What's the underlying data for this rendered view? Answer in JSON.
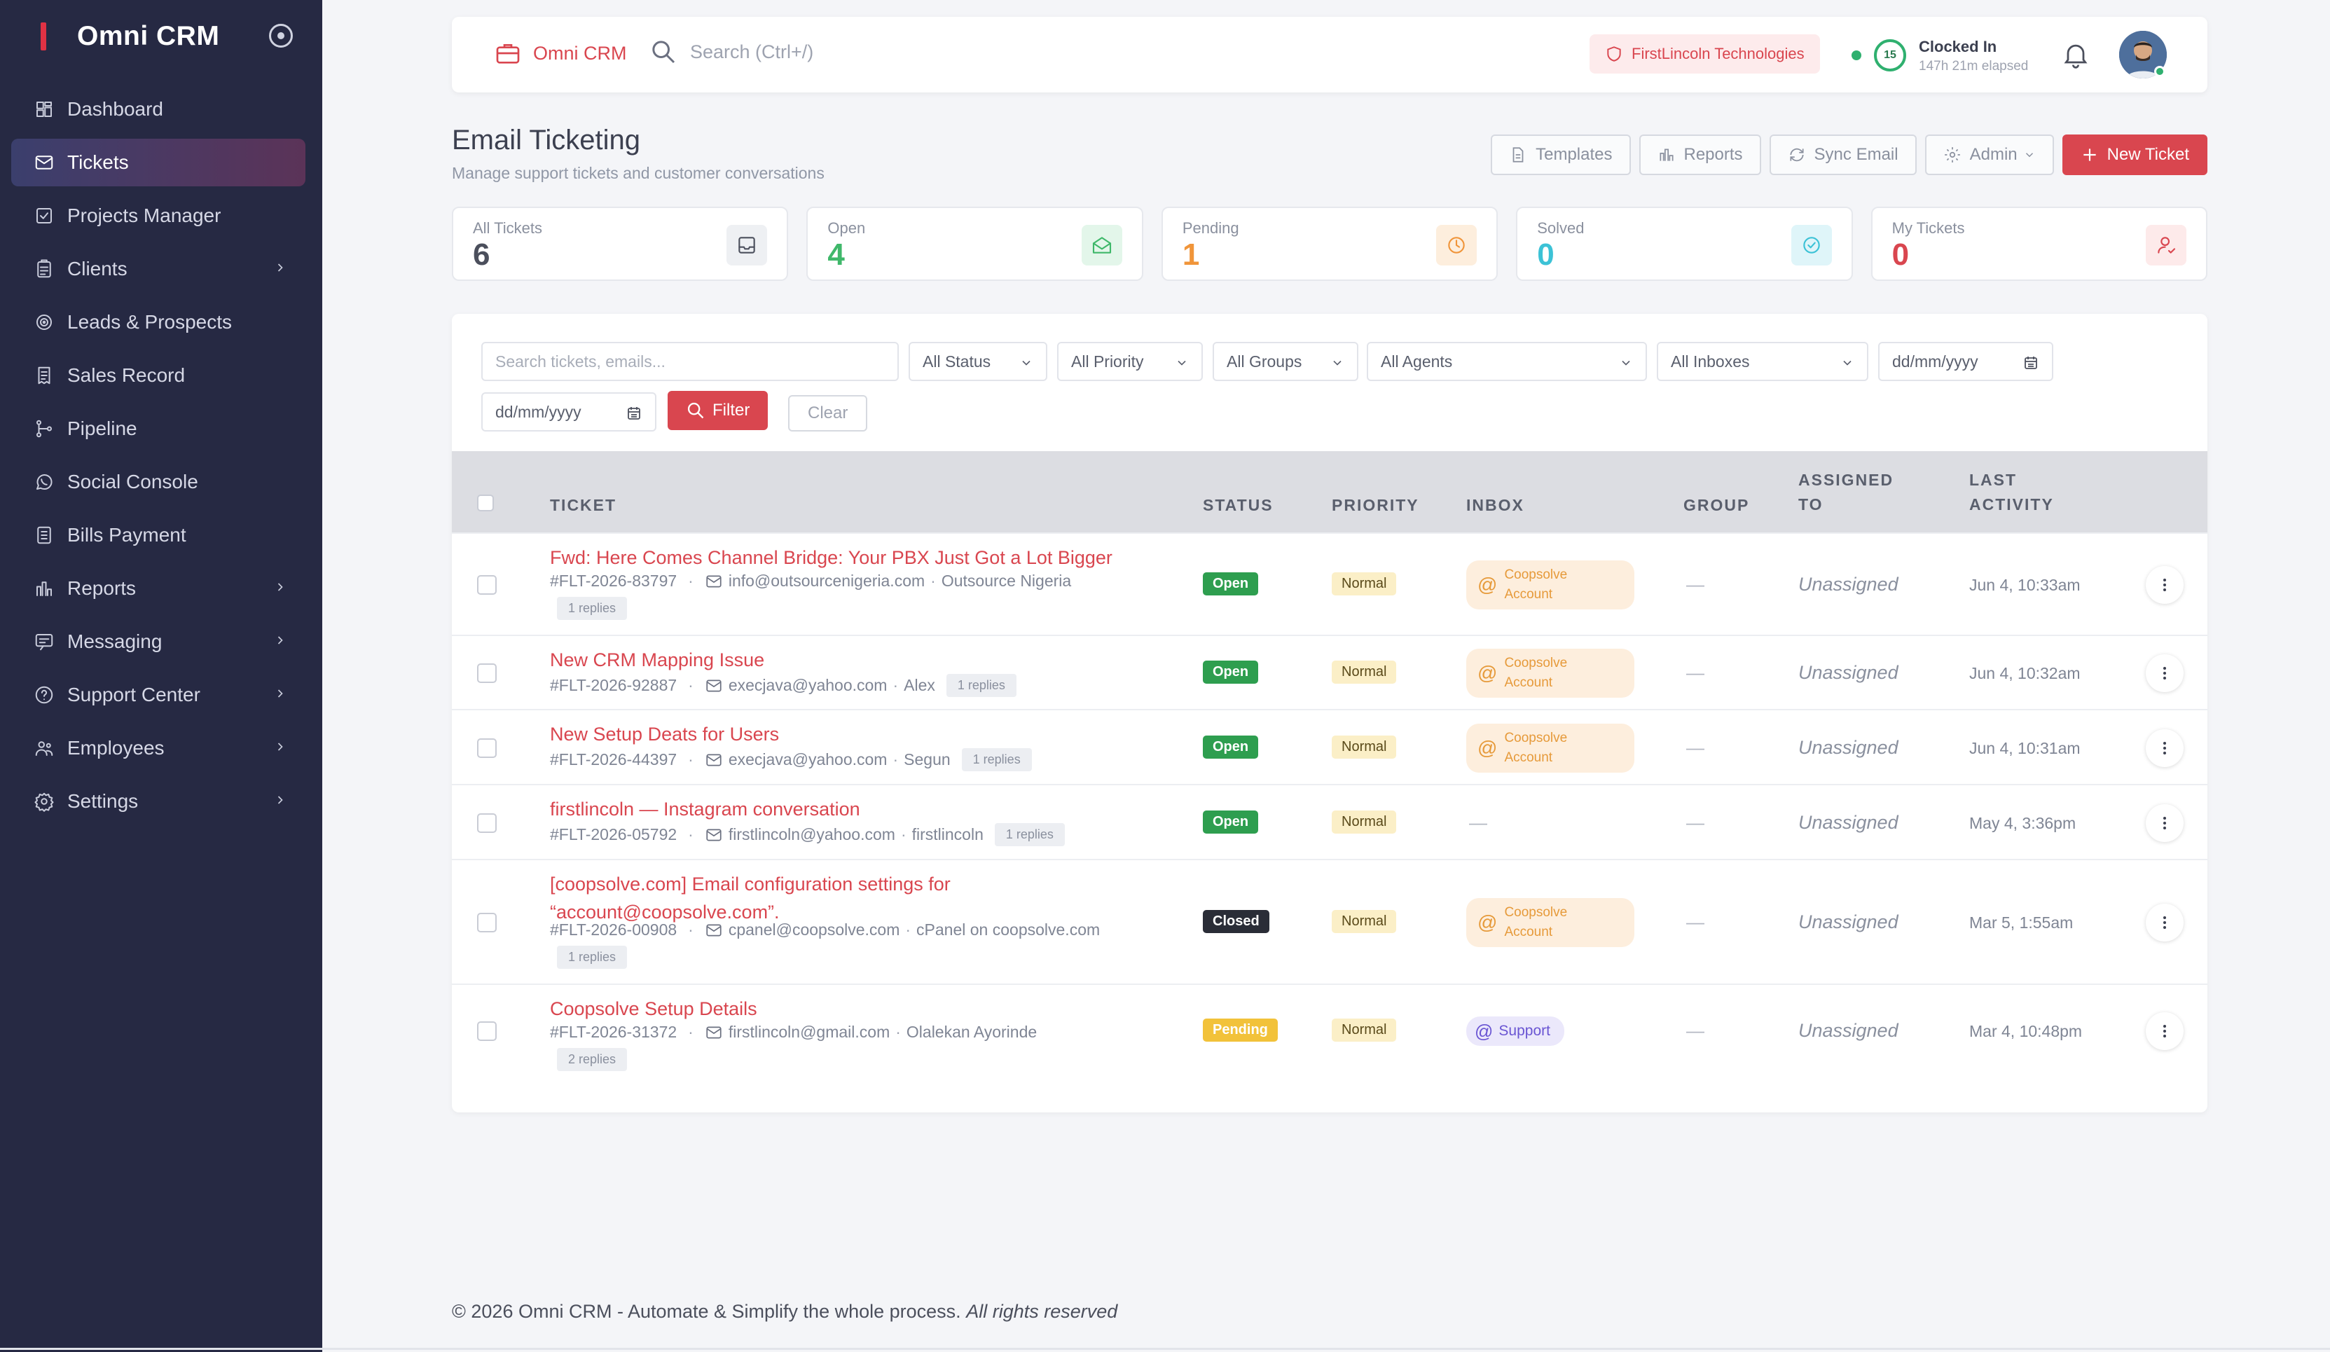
{
  "app": {
    "name": "Omni CRM"
  },
  "sidebar": {
    "items": [
      {
        "label": "Dashboard",
        "icon": "dashboard-icon",
        "active": false,
        "chevron": false
      },
      {
        "label": "Tickets",
        "icon": "mail-icon",
        "active": true,
        "chevron": false
      },
      {
        "label": "Projects Manager",
        "icon": "checkbox-icon",
        "active": false,
        "chevron": false
      },
      {
        "label": "Clients",
        "icon": "clipboard-icon",
        "active": false,
        "chevron": true
      },
      {
        "label": "Leads & Prospects",
        "icon": "target-icon",
        "active": false,
        "chevron": false
      },
      {
        "label": "Sales Record",
        "icon": "receipt-icon",
        "active": false,
        "chevron": false
      },
      {
        "label": "Pipeline",
        "icon": "pipeline-icon",
        "active": false,
        "chevron": false
      },
      {
        "label": "Social Console",
        "icon": "whatsapp-icon",
        "active": false,
        "chevron": false
      },
      {
        "label": "Bills Payment",
        "icon": "bill-icon",
        "active": false,
        "chevron": false
      },
      {
        "label": "Reports",
        "icon": "bar-chart-icon",
        "active": false,
        "chevron": true
      },
      {
        "label": "Messaging",
        "icon": "message-icon",
        "active": false,
        "chevron": true
      },
      {
        "label": "Support Center",
        "icon": "help-icon",
        "active": false,
        "chevron": true
      },
      {
        "label": "Employees",
        "icon": "users-icon",
        "active": false,
        "chevron": true
      },
      {
        "label": "Settings",
        "icon": "gear-icon",
        "active": false,
        "chevron": true
      }
    ]
  },
  "topbar": {
    "brand": "Omni CRM",
    "search_placeholder": "Search (Ctrl+/)",
    "company": "FirstLincoln Technologies",
    "clock_badge": "15",
    "clock_title": "Clocked In",
    "clock_elapsed": "147h 21m elapsed"
  },
  "page": {
    "title": "Email Ticketing",
    "subtitle": "Manage support tickets and customer conversations"
  },
  "actions": {
    "templates": "Templates",
    "reports": "Reports",
    "sync": "Sync Email",
    "admin": "Admin",
    "new_ticket": "New Ticket"
  },
  "stats": [
    {
      "label": "All Tickets",
      "value": "6",
      "color": "#4b4f5c",
      "bg": "#eef0f3",
      "icon": "inbox-icon"
    },
    {
      "label": "Open",
      "value": "4",
      "color": "#3fb86a",
      "bg": "#e3f6ea",
      "icon": "envelope-open-icon"
    },
    {
      "label": "Pending",
      "value": "1",
      "color": "#f0953a",
      "bg": "#fdeedd",
      "icon": "clock-icon"
    },
    {
      "label": "Solved",
      "value": "0",
      "color": "#3cc2d6",
      "bg": "#dff5f9",
      "icon": "check-circle-icon"
    },
    {
      "label": "My Tickets",
      "value": "0",
      "color": "#d9464f",
      "bg": "#fdeaea",
      "icon": "user-icon"
    }
  ],
  "filters": {
    "search_placeholder": "Search tickets, emails...",
    "status": "All Status",
    "priority": "All Priority",
    "groups": "All Groups",
    "agents": "All Agents",
    "inboxes": "All Inboxes",
    "date_from": "dd/mm/yyyy",
    "date_to": "dd/mm/yyyy",
    "filter": "Filter",
    "clear": "Clear"
  },
  "table": {
    "headers": {
      "ticket": "TICKET",
      "status": "STATUS",
      "priority": "PRIORITY",
      "inbox": "INBOX",
      "group": "GROUP",
      "assigned_1": "ASSIGNED",
      "assigned_2": "TO",
      "last_1": "LAST",
      "last_2": "ACTIVITY"
    },
    "rows": [
      {
        "title": "Fwd: Here Comes Channel Bridge: Your PBX Just Got a Lot Bigger",
        "title2": "",
        "id": "#FLT-2026-83797",
        "email": "info@outsourcenigeria.com",
        "name": "Outsource Nigeria",
        "replies": "1 replies",
        "status": "Open",
        "priority": "Normal",
        "inbox": "Coopsolve Account",
        "inbox1": "Coopsolve",
        "inbox2": "Account",
        "group": "—",
        "assigned": "Unassigned",
        "last": "Jun 4, 10:33am"
      },
      {
        "title": "New CRM Mapping Issue",
        "title2": "",
        "id": "#FLT-2026-92887",
        "email": "execjava@yahoo.com",
        "name": "Alex",
        "replies": "1 replies",
        "status": "Open",
        "priority": "Normal",
        "inbox": "Coopsolve Account",
        "inbox1": "Coopsolve",
        "inbox2": "Account",
        "group": "—",
        "assigned": "Unassigned",
        "last": "Jun 4, 10:32am"
      },
      {
        "title": "New Setup Deats for Users",
        "title2": "",
        "id": "#FLT-2026-44397",
        "email": "execjava@yahoo.com",
        "name": "Segun",
        "replies": "1 replies",
        "status": "Open",
        "priority": "Normal",
        "inbox": "Coopsolve Account",
        "inbox1": "Coopsolve",
        "inbox2": "Account",
        "group": "—",
        "assigned": "Unassigned",
        "last": "Jun 4, 10:31am"
      },
      {
        "title": "firstlincoln — Instagram conversation",
        "title2": "",
        "id": "#FLT-2026-05792",
        "email": "firstlincoln@yahoo.com",
        "name": "firstlincoln",
        "replies": "1 replies",
        "status": "Open",
        "priority": "Normal",
        "inbox": "—",
        "group": "—",
        "assigned": "Unassigned",
        "last": "May 4, 3:36pm"
      },
      {
        "title": "[coopsolve.com] Email configuration settings for",
        "title2": "“account@coopsolve.com”.",
        "id": "#FLT-2026-00908",
        "email": "cpanel@coopsolve.com",
        "name": "cPanel on coopsolve.com",
        "replies": "1 replies",
        "status": "Closed",
        "priority": "Normal",
        "inbox": "Coopsolve Account",
        "inbox1": "Coopsolve",
        "inbox2": "Account",
        "group": "—",
        "assigned": "Unassigned",
        "last": "Mar 5, 1:55am"
      },
      {
        "title": "Coopsolve Setup Details",
        "title2": "",
        "id": "#FLT-2026-31372",
        "email": "firstlincoln@gmail.com",
        "name": "Olalekan Ayorinde",
        "replies": "2 replies",
        "status": "Pending",
        "priority": "Normal",
        "inbox": "Support",
        "group": "—",
        "assigned": "Unassigned",
        "last": "Mar 4, 10:48pm"
      }
    ]
  },
  "footer": {
    "text": "© 2026 Omni CRM - Automate & Simplify the whole process.",
    "rights": "All rights reserved"
  }
}
